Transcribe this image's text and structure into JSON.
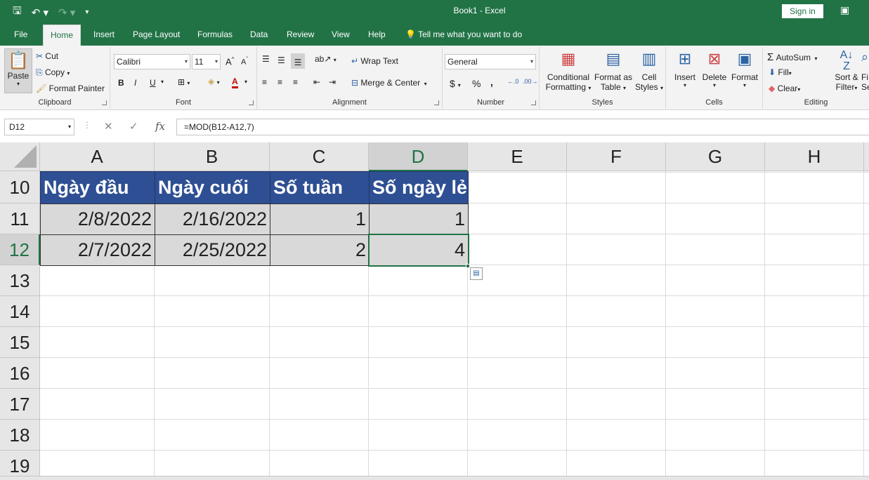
{
  "title": "Book1  -  Excel",
  "signin": "Sign in",
  "tabs": [
    "File",
    "Home",
    "Insert",
    "Page Layout",
    "Formulas",
    "Data",
    "Review",
    "View",
    "Help"
  ],
  "tell_me": "Tell me what you want to do",
  "clipboard": {
    "paste": "Paste",
    "cut": "Cut",
    "copy": "Copy",
    "painter": "Format Painter",
    "label": "Clipboard"
  },
  "font": {
    "name": "Calibri",
    "size": "11",
    "label": "Font",
    "bold": "B",
    "italic": "I",
    "underline": "U"
  },
  "alignment": {
    "wrap": "Wrap Text",
    "merge": "Merge & Center",
    "label": "Alignment"
  },
  "number": {
    "format": "General",
    "currency": "$",
    "percent": "%",
    "comma": ",",
    "label": "Number"
  },
  "styles": {
    "cond1": "Conditional",
    "cond2": "Formatting",
    "fmt1": "Format as",
    "fmt2": "Table",
    "cs1": "Cell",
    "cs2": "Styles",
    "label": "Styles"
  },
  "cells": {
    "insert": "Insert",
    "delete": "Delete",
    "format": "Format",
    "label": "Cells"
  },
  "editing": {
    "autosum": "AutoSum",
    "fill": "Fill",
    "clear": "Clear",
    "sort1": "Sort &",
    "sort2": "Filter",
    "find1": "Fi",
    "find2": "Se",
    "label": "Editing"
  },
  "formula_bar": {
    "name_box": "D12",
    "formula": "=MOD(B12-A12,7)",
    "fx": "fx"
  },
  "columns": [
    "A",
    "B",
    "C",
    "D",
    "E",
    "F",
    "G",
    "H"
  ],
  "rows": [
    "10",
    "11",
    "12",
    "13",
    "14",
    "15",
    "16",
    "17",
    "18",
    "19"
  ],
  "headers": [
    "Ngày đầu",
    "Ngày cuối",
    "Số tuần",
    "Số ngày lẻ"
  ],
  "data": [
    [
      "2/8/2022",
      "2/16/2022",
      "1",
      "1"
    ],
    [
      "2/7/2022",
      "2/25/2022",
      "2",
      "4"
    ]
  ],
  "selected_cell": "D12"
}
